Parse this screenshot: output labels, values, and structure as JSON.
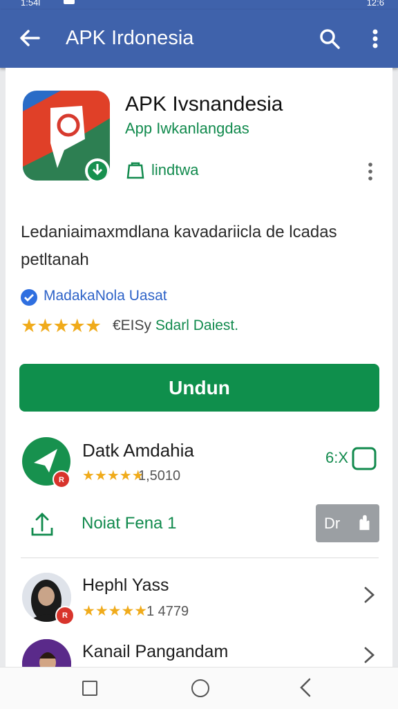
{
  "status_bar": {
    "left": "1:54l",
    "right": "12:6"
  },
  "app_bar": {
    "title": "APK Irdonesia"
  },
  "app": {
    "name": "APK Ivsnandesia",
    "developer": "App Iwkanlangdas",
    "tag": "lindtwa",
    "description": "Ledaniaimaxmdlana kavadariicla de lcadas petltanah",
    "verified_text": "MadakaNola Uasat",
    "stars": "★★★★★",
    "rating_prefix": "€EISy",
    "rating_suffix": "Sdarl Daiest.",
    "install_label": "Undun"
  },
  "related": {
    "name": "Datk Amdahia",
    "stars": "★★★★★",
    "count": "1,5010",
    "action": "6:X",
    "badge": "R",
    "subline": "Noiat Fena 1",
    "gray_button": "Dr"
  },
  "reviews": [
    {
      "name": "Hephl Yass",
      "stars": "★★★★★",
      "count": "1 4779",
      "badge": "R"
    },
    {
      "name": "Kanail Pangandam"
    }
  ],
  "colors": {
    "app_bar": "#3f62ab",
    "accent_green": "#118a4d",
    "install_button": "#0f8f4c",
    "star": "#f0ab1b"
  }
}
